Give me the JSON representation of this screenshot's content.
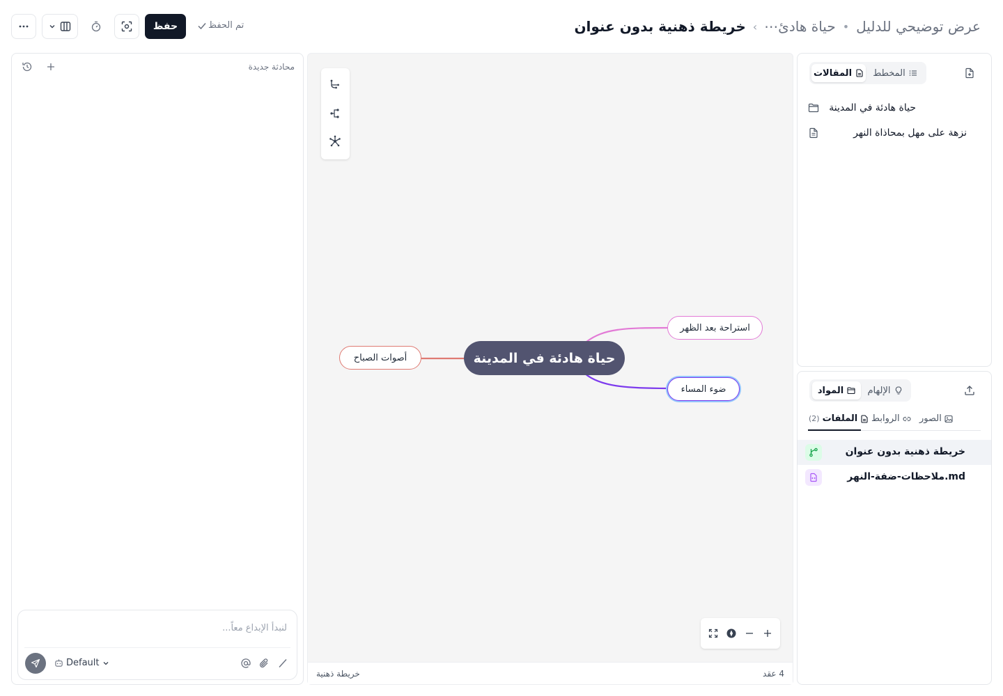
{
  "header": {
    "breadcrumb": {
      "root": "عرض توضيحي للدليل",
      "separator": "•",
      "folder": "حياة هادئ⋯",
      "chevron": "›",
      "current": "خريطة ذهنية بدون عنوان"
    },
    "saved_status": "تم الحفظ",
    "save_label": "حفظ",
    "icons": [
      "more-icon",
      "chevron-down-icon",
      "columns-icon",
      "timer-icon",
      "focus-icon"
    ]
  },
  "chat": {
    "title": "محادثة جديدة",
    "placeholder": "لنبدأ الإبداع معاً...",
    "model": "Default"
  },
  "canvas": {
    "root_label": "حياة هادئة في المدينة",
    "nodes": [
      {
        "label": "استراحة بعد الظهر",
        "color": "#e27ad6"
      },
      {
        "label": "ضوء المساء",
        "color": "#7c3aed"
      },
      {
        "label": "أصوات الصباح",
        "color": "#df7a72"
      }
    ],
    "footer_type": "خريطة ذهنية",
    "footer_count": "4 عقد",
    "selected_node": "ضوء المساء"
  },
  "outline_panel": {
    "tabs": [
      {
        "label": "المقالات",
        "active": true
      },
      {
        "label": "المخطط",
        "active": false
      }
    ],
    "items": [
      {
        "label": "حياة هادئة في المدينة",
        "icon": "folder-icon"
      },
      {
        "label": "نزهة على مهل بمحاذاة النهر",
        "icon": "document-icon"
      }
    ]
  },
  "materials_panel": {
    "tabs": [
      {
        "label": "المواد",
        "active": true
      },
      {
        "label": "الإلهام",
        "active": false
      }
    ],
    "subtabs": [
      {
        "label": "الملفات",
        "count": "(2)",
        "active": true
      },
      {
        "label": "الروابط",
        "active": false
      },
      {
        "label": "الصور",
        "active": false
      }
    ],
    "files": [
      {
        "name": "خريطة ذهنية بدون عنوان",
        "type": "mindmap",
        "active": true,
        "color": "#16a34a"
      },
      {
        "name": "ملاحظات-ضفة-النهر.md",
        "type": "code",
        "active": false,
        "color": "#a855f7"
      }
    ]
  }
}
